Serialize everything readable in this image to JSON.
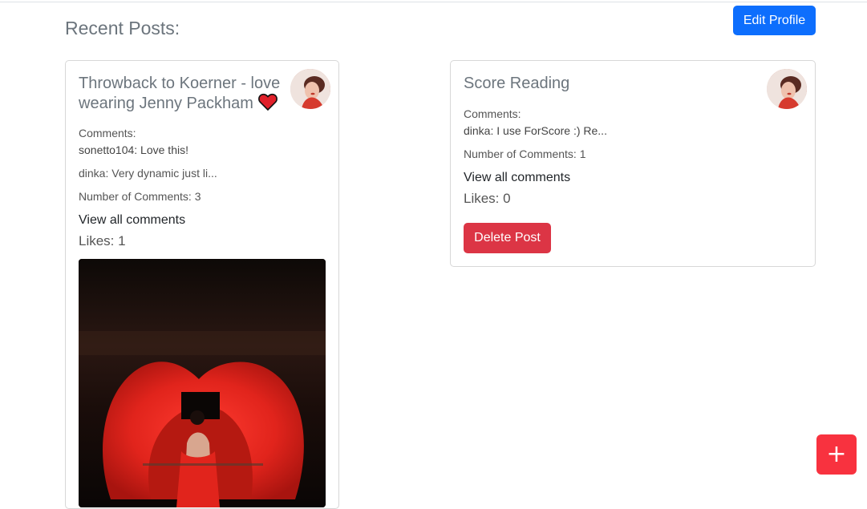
{
  "section_title": "Recent Posts:",
  "edit_profile_label": "Edit Profile",
  "posts": [
    {
      "title": "Throwback to Koerner - love wearing Jenny Packham",
      "title_icon": "heart-icon",
      "comments_label": "Comments:",
      "comments": [
        "sonetto104: Love this!",
        "dinka: Very dynamic just li..."
      ],
      "num_comments_text": "Number of Comments: 3",
      "view_all_label": "View all comments",
      "likes_text": "Likes: 1",
      "has_image": true
    },
    {
      "title": "Score Reading",
      "comments_label": "Comments:",
      "comments": [
        "dinka: I use ForScore :) Re..."
      ],
      "num_comments_text": "Number of Comments: 1",
      "view_all_label": "View all comments",
      "likes_text": "Likes: 0",
      "delete_label": "Delete Post"
    }
  ],
  "fab_label": "+",
  "colors": {
    "primary": "#0d6efd",
    "danger": "#dc3545",
    "fab": "#f8323f",
    "heart": "#e0202a"
  }
}
